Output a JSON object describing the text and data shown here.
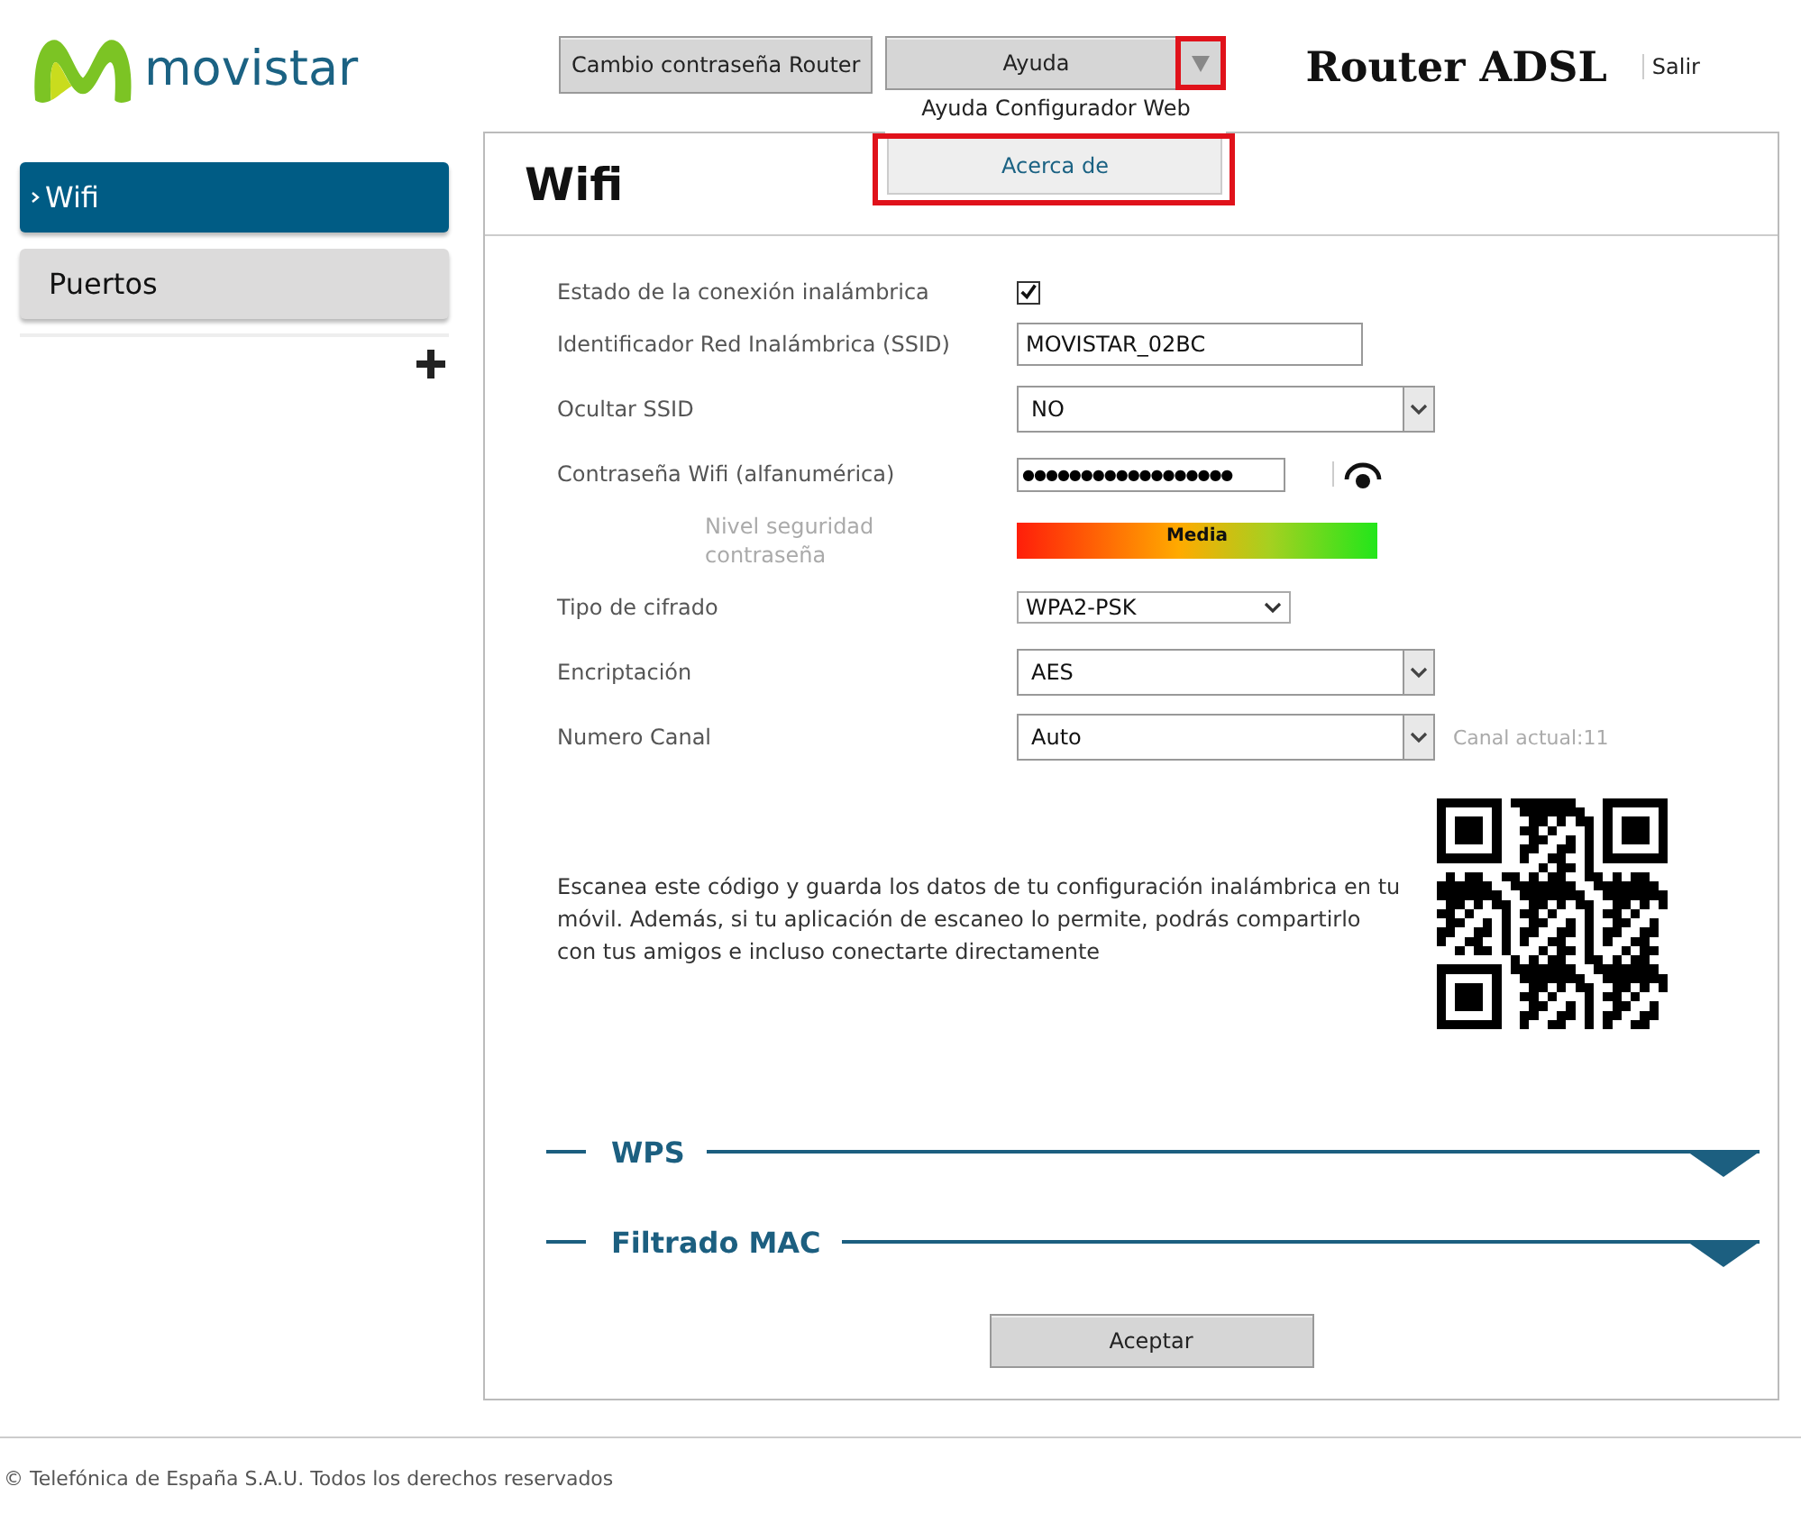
{
  "header": {
    "logo_text": "movistar",
    "buttons": [
      {
        "label": "Cambio contraseña Router"
      }
    ],
    "help_menu": {
      "label": "Ayuda",
      "expanded": true,
      "arrow_highlighted": true,
      "items": [
        {
          "label": "Ayuda Configurador Web",
          "highlighted": false
        },
        {
          "label": "Acerca de",
          "highlighted": true
        }
      ]
    },
    "product": "Router ADSL",
    "logout": "Salir"
  },
  "sidebar": {
    "items": [
      {
        "label": "Wifi",
        "selected": true
      },
      {
        "label": "Puertos",
        "selected": false
      }
    ]
  },
  "panel": {
    "title": "Wifi",
    "fields": [
      {
        "kind": "checkbox",
        "label": "Estado de la conexión inalámbrica",
        "checked": true
      },
      {
        "kind": "text",
        "label": "Identificador Red Inalámbrica (SSID)",
        "value": "MOVISTAR_02BC"
      },
      {
        "kind": "select",
        "label": "Ocultar SSID",
        "value": "NO"
      },
      {
        "kind": "password",
        "label": "Contraseña Wifi (alfanumérica)",
        "value": "●●●●●●●●●●●●●●●●●●"
      },
      {
        "kind": "strength",
        "label": "Nivel seguridad contraseña",
        "reading": "Media"
      },
      {
        "kind": "small_select",
        "label": "Tipo de cifrado",
        "value": "WPA2-PSK"
      },
      {
        "kind": "select",
        "label": "Encriptación",
        "value": "AES"
      },
      {
        "kind": "select",
        "label": "Numero Canal",
        "value": "Auto",
        "note": "Canal actual:11"
      }
    ],
    "qr_text": "Escanea este código y guarda los datos de tu configuración inalámbrica en tu móvil. Además, si tu aplicación de escaneo lo permite, podrás compartirlo con tus amigos e incluso conectarte directamente",
    "sections": [
      {
        "title": "WPS",
        "expanded": false
      },
      {
        "title": "Filtrado MAC",
        "expanded": false
      }
    ],
    "submit": "Aceptar"
  },
  "footer": "© Telefónica de España S.A.U. Todos los derechos reservados"
}
